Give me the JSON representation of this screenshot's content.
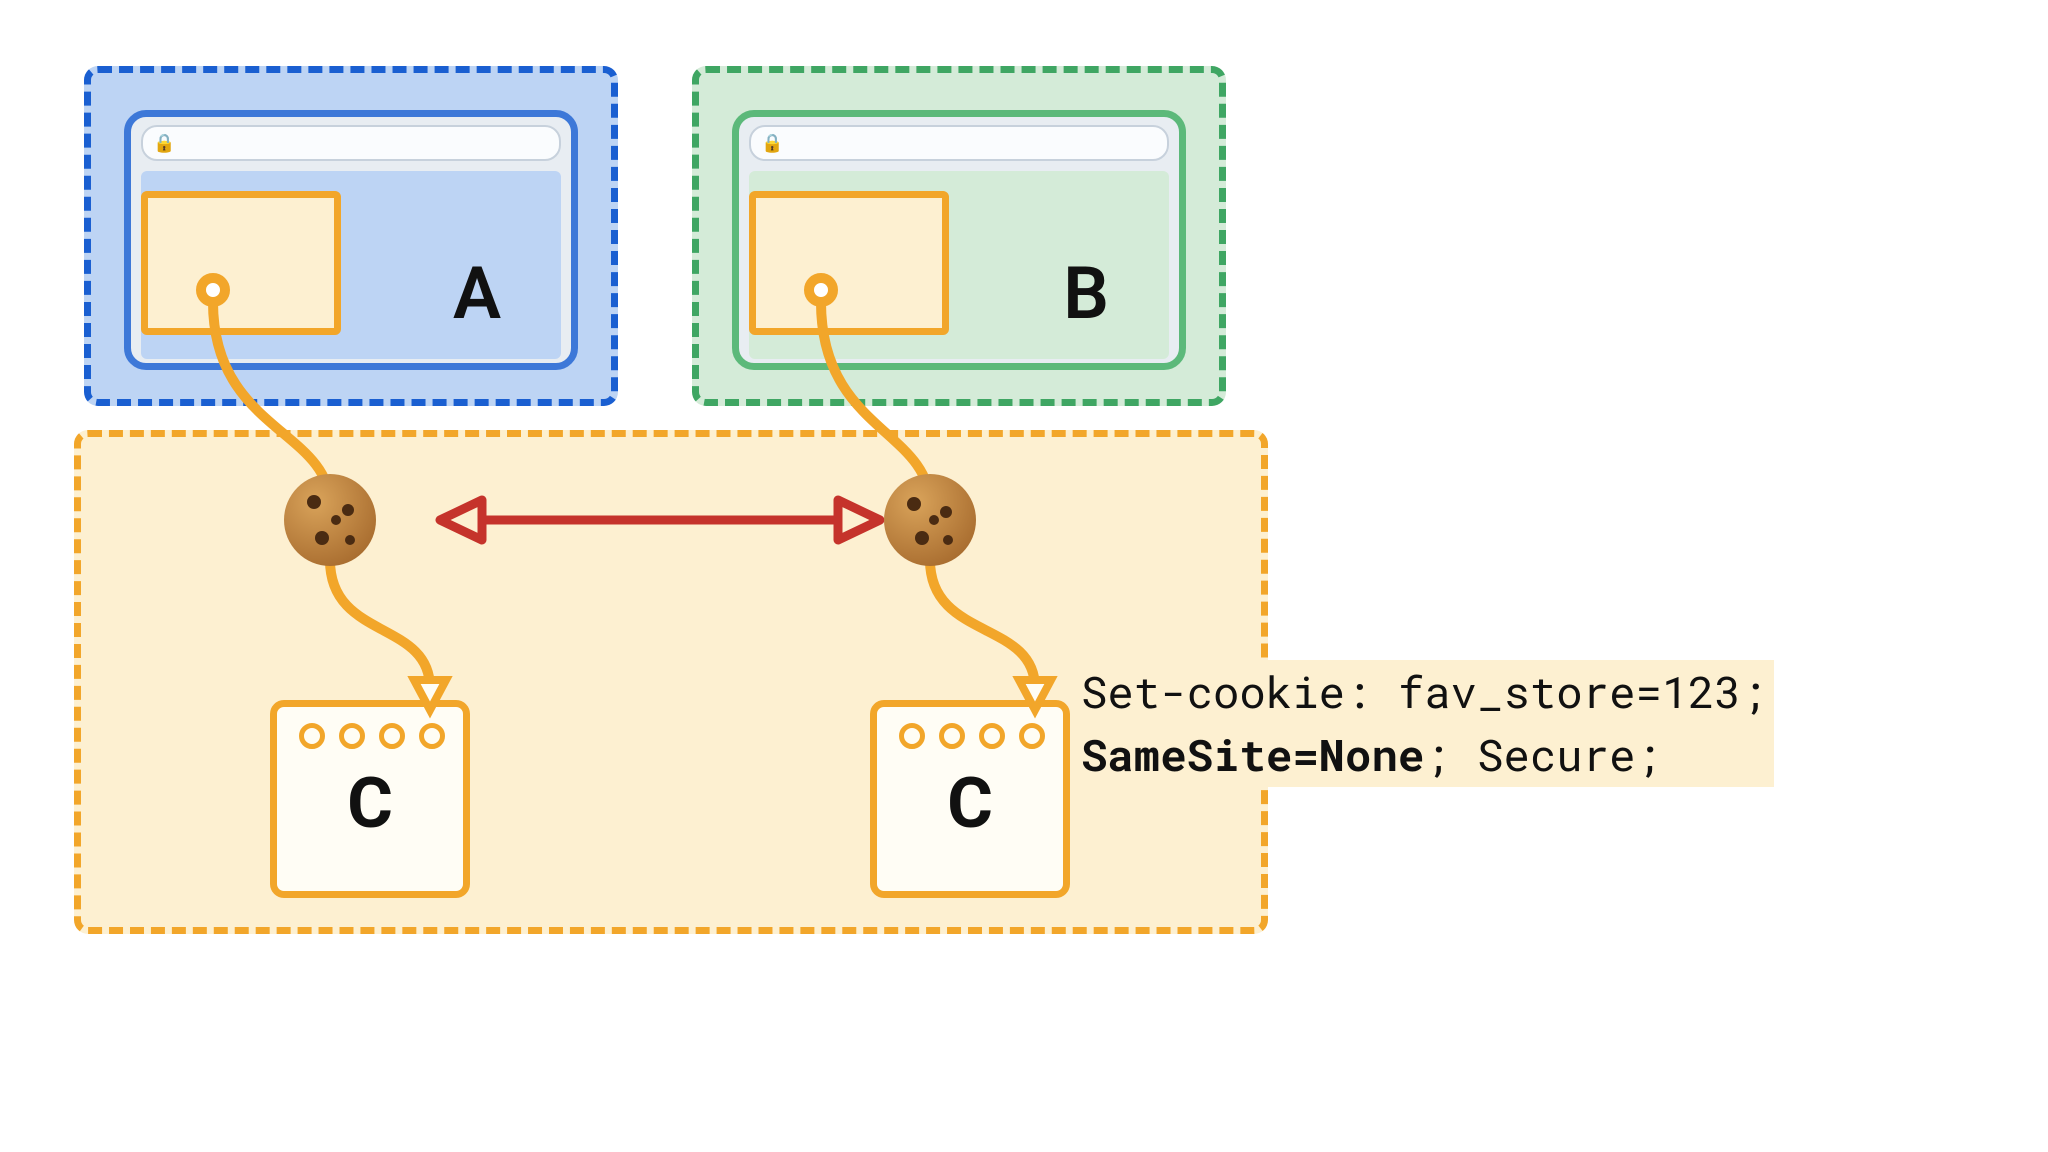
{
  "diagram_type": "cookie-sharing-across-top-level-sites",
  "colors": {
    "site_a": "#1a5fd1",
    "site_b": "#3fa663",
    "third_party": "#f2a62a",
    "arrow": "#c5332b"
  },
  "sites": {
    "a": {
      "label": "A",
      "role": "top-level-site"
    },
    "b": {
      "label": "B",
      "role": "top-level-site"
    },
    "c": {
      "label": "C",
      "role": "third-party-embedded"
    }
  },
  "cookie_header": {
    "line1": "Set-cookie: fav_store=123;",
    "line2_bold": "SameSite=None",
    "line2_rest": "; Secure;"
  },
  "relations": [
    {
      "from": "site-a-embed",
      "via": "cookie",
      "to": "script-c-left"
    },
    {
      "from": "site-b-embed",
      "via": "cookie",
      "to": "script-c-right"
    },
    {
      "between": [
        "cookie-left",
        "cookie-right"
      ],
      "shared": true
    }
  ]
}
